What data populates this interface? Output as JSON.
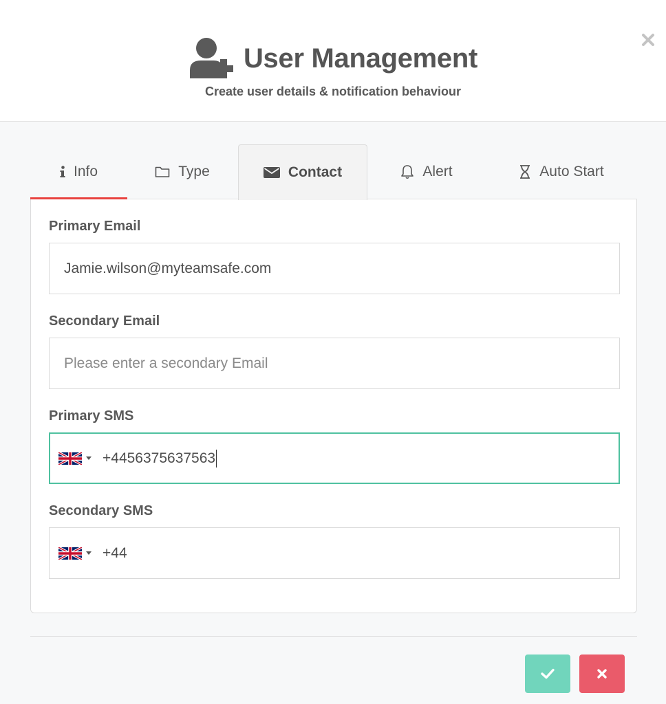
{
  "header": {
    "title": "User Management",
    "subtitle": "Create user details & notification behaviour",
    "close_icon": "close-icon",
    "title_icon": "user-plus-icon"
  },
  "tabs": [
    {
      "label": "Info",
      "icon": "info-icon",
      "active": false
    },
    {
      "label": "Type",
      "icon": "folder-icon",
      "active": false
    },
    {
      "label": "Contact",
      "icon": "envelope-icon",
      "active": true
    },
    {
      "label": "Alert",
      "icon": "bell-icon",
      "active": false
    },
    {
      "label": "Auto Start",
      "icon": "hourglass-icon",
      "active": false
    }
  ],
  "form": {
    "primary_email": {
      "label": "Primary Email",
      "value": "Jamie.wilson@myteamsafe.com"
    },
    "secondary_email": {
      "label": "Secondary Email",
      "value": "",
      "placeholder": "Please enter a secondary Email"
    },
    "primary_sms": {
      "label": "Primary SMS",
      "value": "+4456375637563",
      "country_flag": "uk-flag-icon"
    },
    "secondary_sms": {
      "label": "Secondary SMS",
      "value": "+44",
      "country_flag": "uk-flag-icon"
    }
  },
  "actions": {
    "confirm_icon": "check-icon",
    "cancel_icon": "close-icon"
  },
  "colors": {
    "accent_green": "#71d5bc",
    "focus_green": "#4fc1a0",
    "danger_red": "#ea5b6a",
    "tab_underline": "#e8423f"
  }
}
